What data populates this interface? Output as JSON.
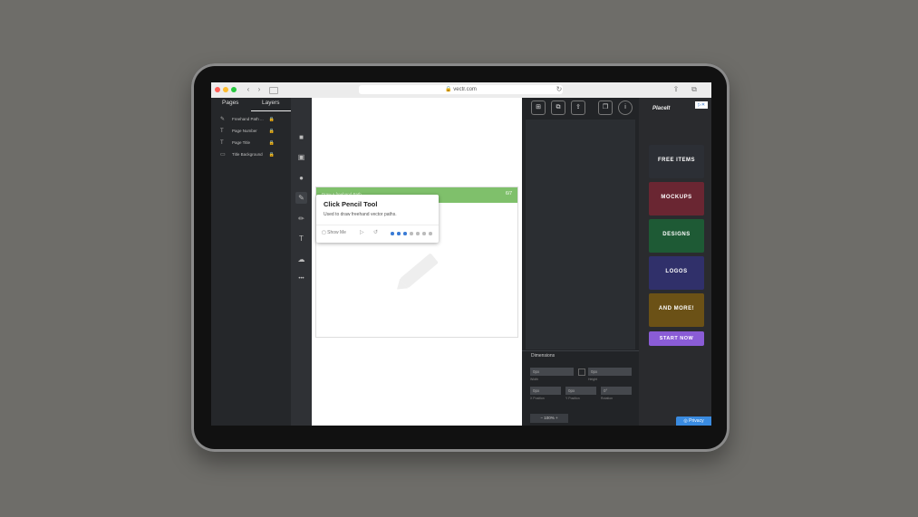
{
  "browser": {
    "url": "vectr.com",
    "dots": [
      "#ff5f57",
      "#febc2e",
      "#28c840"
    ],
    "back_icon": "chevron-left-icon",
    "forward_icon": "chevron-right-icon"
  },
  "left_panel": {
    "tabs": [
      {
        "label": "Pages"
      },
      {
        "label": "Layers"
      }
    ],
    "active_tab": "Layers",
    "layers": [
      {
        "label": "Freehand Path ...",
        "icon": "path-icon"
      },
      {
        "label": "Page Number",
        "icon": "text-icon"
      },
      {
        "label": "Page Title",
        "icon": "text-icon"
      },
      {
        "label": "Title Background",
        "icon": "rect-icon"
      }
    ]
  },
  "tools": [
    {
      "name": "rectangle-tool",
      "glyph": "■"
    },
    {
      "name": "rounded-rect-tool",
      "glyph": "▣"
    },
    {
      "name": "ellipse-tool",
      "glyph": "●"
    },
    {
      "name": "pen-tool",
      "glyph": "✎",
      "active": true
    },
    {
      "name": "pencil-tool",
      "glyph": "✏"
    },
    {
      "name": "text-tool",
      "glyph": "T"
    },
    {
      "name": "import-tool",
      "glyph": "☁"
    },
    {
      "name": "more-tool",
      "glyph": "•••"
    }
  ],
  "canvas": {
    "green_bar_title": "Draw a freehand Path",
    "green_bar_count": "6/7",
    "tooltip": {
      "title": "Click Pencil Tool",
      "description": "Used to draw freehand vector paths.",
      "show_me": "Show Me",
      "progress_total": 7,
      "progress_done": 3
    }
  },
  "inspector": {
    "dimensions_title": "Dimensions",
    "fields": [
      {
        "value": "0px",
        "caption": "Width"
      },
      {
        "value": "0px",
        "caption": "Height"
      },
      {
        "value": "0px",
        "caption": "X Position"
      },
      {
        "value": "0px",
        "caption": "Y Position"
      },
      {
        "value": "0°",
        "caption": "Rotation"
      }
    ],
    "zoom": "100%"
  },
  "ad": {
    "logo": "PlaceIt",
    "badge": "▷✕",
    "tiles": [
      {
        "label": "FREE ITEMS",
        "color": "#2c2f35"
      },
      {
        "label": "MOCKUPS",
        "color": "#6a2632"
      },
      {
        "label": "DESIGNS",
        "color": "#1e5a35"
      },
      {
        "label": "LOGOS",
        "color": "#30306a"
      },
      {
        "label": "AND MORE!",
        "color": "#6b5116"
      }
    ],
    "start_label": "START NOW"
  },
  "privacy_label": "Privacy"
}
